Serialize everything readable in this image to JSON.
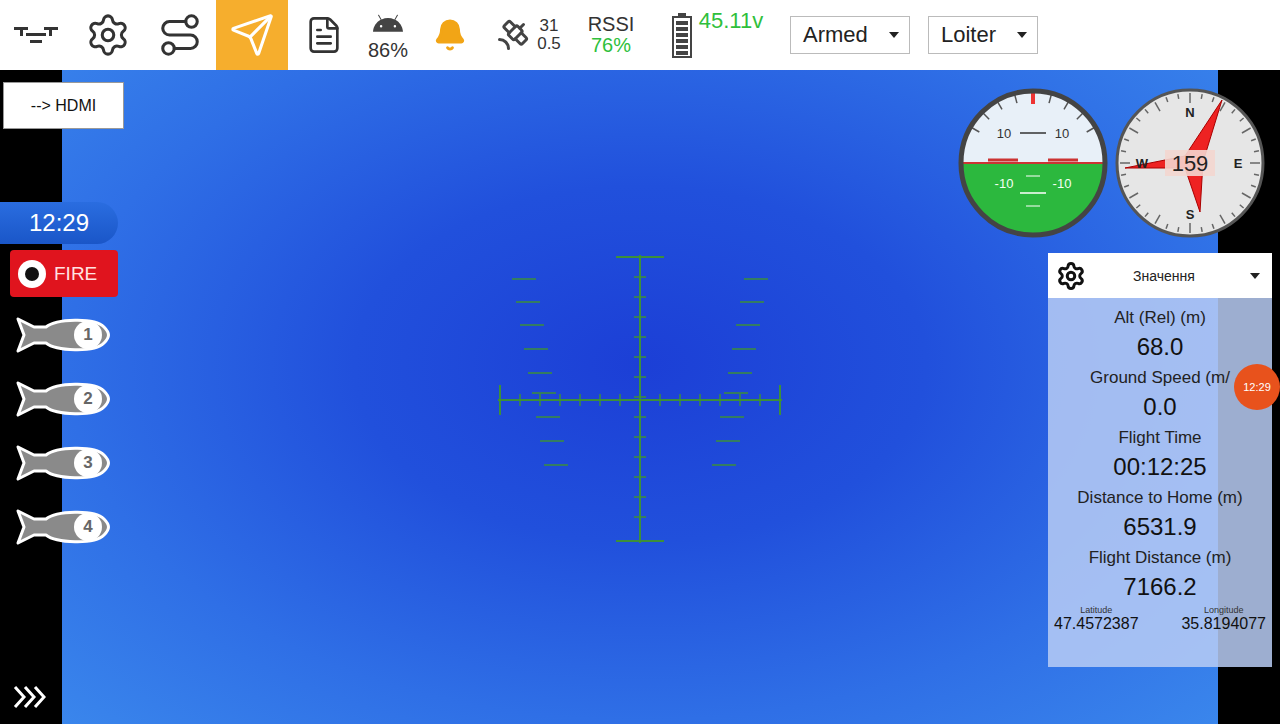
{
  "toolbar": {
    "tools": [
      {
        "kind": "drone",
        "selected": false
      },
      {
        "kind": "settings",
        "selected": false
      },
      {
        "kind": "route",
        "selected": false
      },
      {
        "kind": "send",
        "selected": true
      },
      {
        "kind": "log",
        "selected": false
      }
    ],
    "phone_battery": "86%",
    "satellites": "31",
    "hdop": "0.5",
    "rssi_label": "RSSI",
    "rssi": "76%",
    "battery_level": 1,
    "voltage": "45.11v",
    "arm_state": "Armed",
    "flight_mode": "Loiter"
  },
  "hdmi_button": "--> HDMI",
  "clock": "12:29",
  "fire_button": "FIRE",
  "bombs": [
    "1",
    "2",
    "3",
    "4"
  ],
  "attitude": {
    "marks": [
      "10",
      "10",
      "-10",
      "-10"
    ]
  },
  "compass": {
    "heading": "159",
    "cardinals": [
      "N",
      "E",
      "S",
      "W"
    ]
  },
  "telemetry": {
    "title": "Значення",
    "items": [
      {
        "label": "Alt (Rel) (m)",
        "value": "68.0"
      },
      {
        "label": "Ground Speed (m/",
        "value": "0.0"
      },
      {
        "label": "Flight Time",
        "value": "00:12:25"
      },
      {
        "label": "Distance to Home (m)",
        "value": "6531.9"
      },
      {
        "label": "Flight Distance (m)",
        "value": "7166.2"
      }
    ],
    "latitude_label": "Latitude",
    "latitude": "47.4572387",
    "longitude_label": "Longitude",
    "longitude": "35.8194077"
  },
  "badge": "12:29"
}
